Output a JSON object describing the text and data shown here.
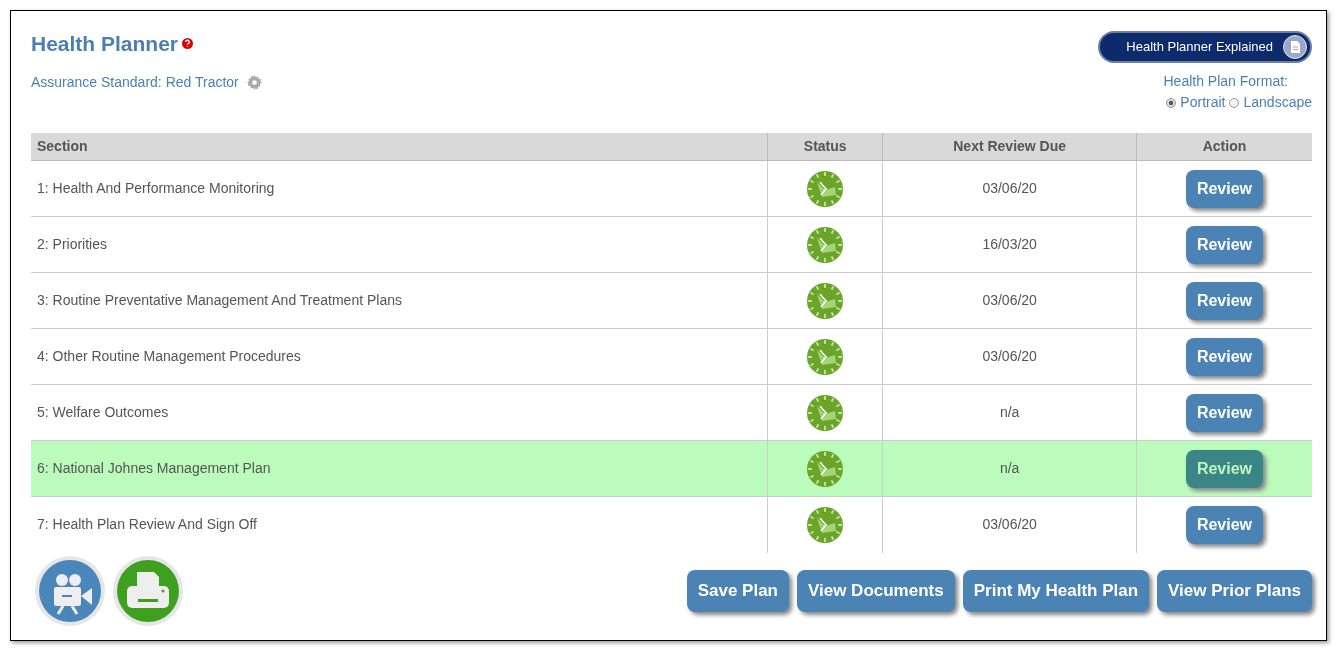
{
  "title": "Health Planner",
  "assurance": "Assurance Standard: Red Tractor",
  "explain_button": "Health Planner Explained",
  "format": {
    "label": "Health Plan Format:",
    "options": [
      {
        "label": "Portrait",
        "selected": true
      },
      {
        "label": "Landscape",
        "selected": false
      }
    ]
  },
  "table": {
    "columns": [
      "Section",
      "Status",
      "Next Review Due",
      "Action"
    ],
    "rows": [
      {
        "section": "1: Health And Performance Monitoring",
        "next_review": "03/06/20",
        "action": "Review",
        "selected": false
      },
      {
        "section": "2: Priorities",
        "next_review": "16/03/20",
        "action": "Review",
        "selected": false
      },
      {
        "section": "3: Routine Preventative Management And Treatment Plans",
        "next_review": "03/06/20",
        "action": "Review",
        "selected": false
      },
      {
        "section": "4: Other Routine Management Procedures",
        "next_review": "03/06/20",
        "action": "Review",
        "selected": false
      },
      {
        "section": "5: Welfare Outcomes",
        "next_review": "n/a",
        "action": "Review",
        "selected": false
      },
      {
        "section": "6: National Johnes Management Plan",
        "next_review": "n/a",
        "action": "Review",
        "selected": true
      },
      {
        "section": "7: Health Plan Review And Sign Off",
        "next_review": "03/06/20",
        "action": "Review",
        "selected": false
      }
    ]
  },
  "footer_buttons": [
    "Save Plan",
    "View Documents",
    "Print My Health Plan",
    "View Prior Plans"
  ]
}
